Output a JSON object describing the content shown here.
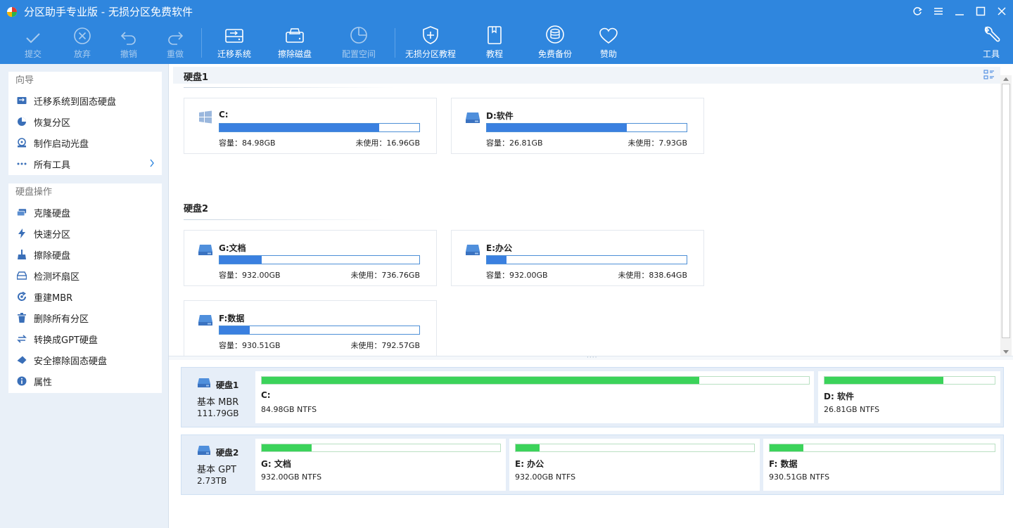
{
  "window": {
    "title": "分区助手专业版 - 无损分区免费软件",
    "controls": [
      "refresh-icon",
      "menu-icon",
      "minimize-icon",
      "maximize-icon",
      "close-icon"
    ]
  },
  "toolbar": {
    "commit": "提交",
    "discard": "放弃",
    "undo": "撤销",
    "redo": "重做",
    "migrate": "迁移系统",
    "wipe_disk": "擦除磁盘",
    "allocate": "配置空间",
    "tutorial_lossless": "无损分区教程",
    "tutorial": "教程",
    "backup": "免费备份",
    "sponsor": "赞助",
    "tools": "工具"
  },
  "sidebar": {
    "wizard_title": "向导",
    "wizard_items": [
      {
        "label": "迁移系统到固态硬盘",
        "icon": "migrate-ssd-icon"
      },
      {
        "label": "恢复分区",
        "icon": "recover-partition-icon"
      },
      {
        "label": "制作启动光盘",
        "icon": "boot-disc-icon"
      },
      {
        "label": "所有工具",
        "icon": "more-dots-icon"
      }
    ],
    "disk_ops_title": "硬盘操作",
    "disk_ops_items": [
      {
        "label": "克隆硬盘",
        "icon": "clone-disk-icon"
      },
      {
        "label": "快速分区",
        "icon": "lightning-icon"
      },
      {
        "label": "擦除硬盘",
        "icon": "broom-icon"
      },
      {
        "label": "检测坏扇区",
        "icon": "check-sector-icon"
      },
      {
        "label": "重建MBR",
        "icon": "rebuild-mbr-icon"
      },
      {
        "label": "删除所有分区",
        "icon": "trash-icon"
      },
      {
        "label": "转换成GPT硬盘",
        "icon": "convert-icon"
      },
      {
        "label": "安全擦除固态硬盘",
        "icon": "eraser-icon"
      },
      {
        "label": "属性",
        "icon": "info-icon"
      }
    ]
  },
  "cards_view": {
    "disks": [
      {
        "label": "硬盘1",
        "partitions": [
          {
            "name": "C:",
            "capacity": "容量：84.98GB",
            "free": "未使用：16.96GB",
            "used_fraction": 0.8,
            "icon": "windows-icon"
          },
          {
            "name": "D:软件",
            "capacity": "容量：26.81GB",
            "free": "未使用：7.93GB",
            "used_fraction": 0.7,
            "icon": "drive-icon"
          }
        ]
      },
      {
        "label": "硬盘2",
        "partitions": [
          {
            "name": "G:文档",
            "capacity": "容量：932.00GB",
            "free": "未使用：736.76GB",
            "used_fraction": 0.21,
            "icon": "drive-icon"
          },
          {
            "name": "E:办公",
            "capacity": "容量：932.00GB",
            "free": "未使用：838.64GB",
            "used_fraction": 0.1,
            "icon": "drive-icon"
          },
          {
            "name": "F:数据",
            "capacity": "容量：930.51GB",
            "free": "未使用：792.57GB",
            "used_fraction": 0.15,
            "icon": "drive-icon"
          }
        ]
      }
    ]
  },
  "map_view": {
    "disks": [
      {
        "name": "硬盘1",
        "type": "基本 MBR",
        "size": "111.79GB",
        "partitions": [
          {
            "name": "C:",
            "fs": "84.98GB NTFS",
            "used_fraction": 0.8
          },
          {
            "name": "D: 软件",
            "fs": "26.81GB NTFS",
            "used_fraction": 0.7
          }
        ]
      },
      {
        "name": "硬盘2",
        "type": "基本 GPT",
        "size": "2.73TB",
        "partitions": [
          {
            "name": "G: 文档",
            "fs": "932.00GB NTFS",
            "used_fraction": 0.21
          },
          {
            "name": "E: 办公",
            "fs": "932.00GB NTFS",
            "used_fraction": 0.1
          },
          {
            "name": "F: 数据",
            "fs": "930.51GB NTFS",
            "used_fraction": 0.15
          }
        ]
      }
    ]
  },
  "colors": {
    "accent": "#2f86de",
    "card_bar": "#3a80e0",
    "map_bar": "#3bd35a",
    "sidebar_bg": "#e9f0f8"
  }
}
